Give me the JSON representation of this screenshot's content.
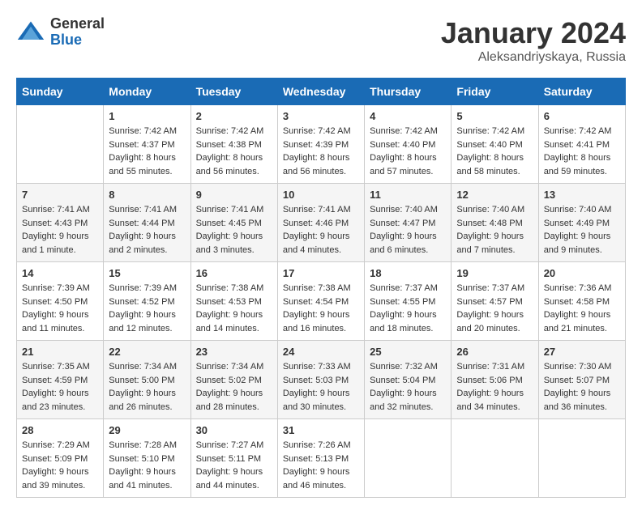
{
  "logo": {
    "general": "General",
    "blue": "Blue"
  },
  "header": {
    "title": "January 2024",
    "subtitle": "Aleksandriyskaya, Russia"
  },
  "weekdays": [
    "Sunday",
    "Monday",
    "Tuesday",
    "Wednesday",
    "Thursday",
    "Friday",
    "Saturday"
  ],
  "weeks": [
    [
      {
        "day": "",
        "sunrise": "",
        "sunset": "",
        "daylight": ""
      },
      {
        "day": "1",
        "sunrise": "Sunrise: 7:42 AM",
        "sunset": "Sunset: 4:37 PM",
        "daylight": "Daylight: 8 hours and 55 minutes."
      },
      {
        "day": "2",
        "sunrise": "Sunrise: 7:42 AM",
        "sunset": "Sunset: 4:38 PM",
        "daylight": "Daylight: 8 hours and 56 minutes."
      },
      {
        "day": "3",
        "sunrise": "Sunrise: 7:42 AM",
        "sunset": "Sunset: 4:39 PM",
        "daylight": "Daylight: 8 hours and 56 minutes."
      },
      {
        "day": "4",
        "sunrise": "Sunrise: 7:42 AM",
        "sunset": "Sunset: 4:40 PM",
        "daylight": "Daylight: 8 hours and 57 minutes."
      },
      {
        "day": "5",
        "sunrise": "Sunrise: 7:42 AM",
        "sunset": "Sunset: 4:40 PM",
        "daylight": "Daylight: 8 hours and 58 minutes."
      },
      {
        "day": "6",
        "sunrise": "Sunrise: 7:42 AM",
        "sunset": "Sunset: 4:41 PM",
        "daylight": "Daylight: 8 hours and 59 minutes."
      }
    ],
    [
      {
        "day": "7",
        "sunrise": "Sunrise: 7:41 AM",
        "sunset": "Sunset: 4:43 PM",
        "daylight": "Daylight: 9 hours and 1 minute."
      },
      {
        "day": "8",
        "sunrise": "Sunrise: 7:41 AM",
        "sunset": "Sunset: 4:44 PM",
        "daylight": "Daylight: 9 hours and 2 minutes."
      },
      {
        "day": "9",
        "sunrise": "Sunrise: 7:41 AM",
        "sunset": "Sunset: 4:45 PM",
        "daylight": "Daylight: 9 hours and 3 minutes."
      },
      {
        "day": "10",
        "sunrise": "Sunrise: 7:41 AM",
        "sunset": "Sunset: 4:46 PM",
        "daylight": "Daylight: 9 hours and 4 minutes."
      },
      {
        "day": "11",
        "sunrise": "Sunrise: 7:40 AM",
        "sunset": "Sunset: 4:47 PM",
        "daylight": "Daylight: 9 hours and 6 minutes."
      },
      {
        "day": "12",
        "sunrise": "Sunrise: 7:40 AM",
        "sunset": "Sunset: 4:48 PM",
        "daylight": "Daylight: 9 hours and 7 minutes."
      },
      {
        "day": "13",
        "sunrise": "Sunrise: 7:40 AM",
        "sunset": "Sunset: 4:49 PM",
        "daylight": "Daylight: 9 hours and 9 minutes."
      }
    ],
    [
      {
        "day": "14",
        "sunrise": "Sunrise: 7:39 AM",
        "sunset": "Sunset: 4:50 PM",
        "daylight": "Daylight: 9 hours and 11 minutes."
      },
      {
        "day": "15",
        "sunrise": "Sunrise: 7:39 AM",
        "sunset": "Sunset: 4:52 PM",
        "daylight": "Daylight: 9 hours and 12 minutes."
      },
      {
        "day": "16",
        "sunrise": "Sunrise: 7:38 AM",
        "sunset": "Sunset: 4:53 PM",
        "daylight": "Daylight: 9 hours and 14 minutes."
      },
      {
        "day": "17",
        "sunrise": "Sunrise: 7:38 AM",
        "sunset": "Sunset: 4:54 PM",
        "daylight": "Daylight: 9 hours and 16 minutes."
      },
      {
        "day": "18",
        "sunrise": "Sunrise: 7:37 AM",
        "sunset": "Sunset: 4:55 PM",
        "daylight": "Daylight: 9 hours and 18 minutes."
      },
      {
        "day": "19",
        "sunrise": "Sunrise: 7:37 AM",
        "sunset": "Sunset: 4:57 PM",
        "daylight": "Daylight: 9 hours and 20 minutes."
      },
      {
        "day": "20",
        "sunrise": "Sunrise: 7:36 AM",
        "sunset": "Sunset: 4:58 PM",
        "daylight": "Daylight: 9 hours and 21 minutes."
      }
    ],
    [
      {
        "day": "21",
        "sunrise": "Sunrise: 7:35 AM",
        "sunset": "Sunset: 4:59 PM",
        "daylight": "Daylight: 9 hours and 23 minutes."
      },
      {
        "day": "22",
        "sunrise": "Sunrise: 7:34 AM",
        "sunset": "Sunset: 5:00 PM",
        "daylight": "Daylight: 9 hours and 26 minutes."
      },
      {
        "day": "23",
        "sunrise": "Sunrise: 7:34 AM",
        "sunset": "Sunset: 5:02 PM",
        "daylight": "Daylight: 9 hours and 28 minutes."
      },
      {
        "day": "24",
        "sunrise": "Sunrise: 7:33 AM",
        "sunset": "Sunset: 5:03 PM",
        "daylight": "Daylight: 9 hours and 30 minutes."
      },
      {
        "day": "25",
        "sunrise": "Sunrise: 7:32 AM",
        "sunset": "Sunset: 5:04 PM",
        "daylight": "Daylight: 9 hours and 32 minutes."
      },
      {
        "day": "26",
        "sunrise": "Sunrise: 7:31 AM",
        "sunset": "Sunset: 5:06 PM",
        "daylight": "Daylight: 9 hours and 34 minutes."
      },
      {
        "day": "27",
        "sunrise": "Sunrise: 7:30 AM",
        "sunset": "Sunset: 5:07 PM",
        "daylight": "Daylight: 9 hours and 36 minutes."
      }
    ],
    [
      {
        "day": "28",
        "sunrise": "Sunrise: 7:29 AM",
        "sunset": "Sunset: 5:09 PM",
        "daylight": "Daylight: 9 hours and 39 minutes."
      },
      {
        "day": "29",
        "sunrise": "Sunrise: 7:28 AM",
        "sunset": "Sunset: 5:10 PM",
        "daylight": "Daylight: 9 hours and 41 minutes."
      },
      {
        "day": "30",
        "sunrise": "Sunrise: 7:27 AM",
        "sunset": "Sunset: 5:11 PM",
        "daylight": "Daylight: 9 hours and 44 minutes."
      },
      {
        "day": "31",
        "sunrise": "Sunrise: 7:26 AM",
        "sunset": "Sunset: 5:13 PM",
        "daylight": "Daylight: 9 hours and 46 minutes."
      },
      {
        "day": "",
        "sunrise": "",
        "sunset": "",
        "daylight": ""
      },
      {
        "day": "",
        "sunrise": "",
        "sunset": "",
        "daylight": ""
      },
      {
        "day": "",
        "sunrise": "",
        "sunset": "",
        "daylight": ""
      }
    ]
  ]
}
